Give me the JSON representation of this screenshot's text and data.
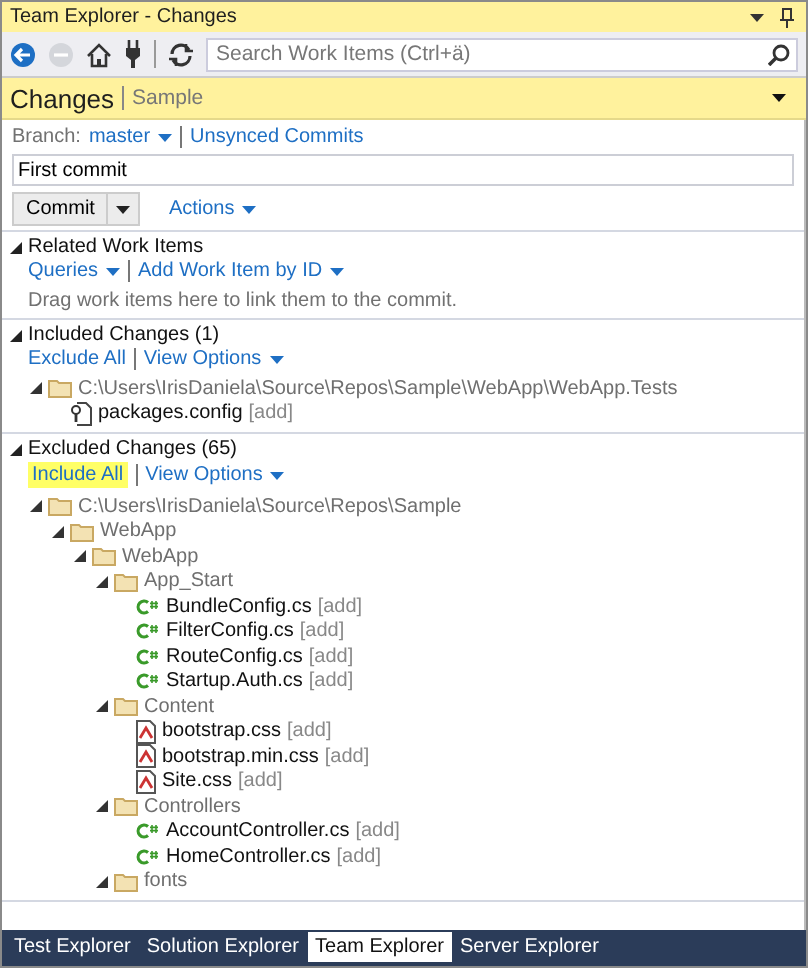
{
  "window": {
    "title": "Team Explorer - Changes"
  },
  "toolbar": {
    "search": {
      "placeholder": "Search Work Items (Ctrl+ä)"
    }
  },
  "header": {
    "title": "Changes",
    "subtitle": "Sample"
  },
  "branch": {
    "label": "Branch:",
    "value": "master",
    "link": "Unsynced Commits"
  },
  "commit_message": {
    "value": "First commit"
  },
  "commit_button": "Commit",
  "actions": "Actions",
  "sections": [
    {
      "title": "Related Work Items",
      "expanded": true,
      "links": [
        {
          "label": "Queries",
          "dropdown": true,
          "highlighted": false
        },
        {
          "label": "Add Work Item by ID",
          "dropdown": true,
          "highlighted": false
        }
      ],
      "hint": "Drag work items here to link them to the commit."
    },
    {
      "title": "Included Changes (1)",
      "expanded": true,
      "links": [
        {
          "label": "Exclude All",
          "dropdown": false,
          "highlighted": false
        },
        {
          "label": "View Options",
          "dropdown": true,
          "highlighted": false
        }
      ],
      "tree": [
        {
          "kind": "folder",
          "label": "C:\\Users\\IrisDaniela\\Source\\Repos\\Sample\\WebApp\\WebApp.Tests",
          "expanded": true,
          "children": [
            {
              "kind": "config",
              "label": "packages.config",
              "tag": "[add]"
            }
          ]
        }
      ]
    },
    {
      "title": "Excluded Changes (65)",
      "expanded": true,
      "links": [
        {
          "label": "Include All",
          "dropdown": false,
          "highlighted": true
        },
        {
          "label": "View Options",
          "dropdown": true,
          "highlighted": false
        }
      ],
      "tree": [
        {
          "kind": "folder",
          "label": "C:\\Users\\IrisDaniela\\Source\\Repos\\Sample",
          "expanded": true,
          "children": [
            {
              "kind": "folder",
              "label": "WebApp",
              "expanded": true,
              "children": [
                {
                  "kind": "folder",
                  "label": "WebApp",
                  "expanded": true,
                  "children": [
                    {
                      "kind": "folder",
                      "label": "App_Start",
                      "expanded": true,
                      "children": [
                        {
                          "kind": "cs",
                          "label": "BundleConfig.cs",
                          "tag": "[add]"
                        },
                        {
                          "kind": "cs",
                          "label": "FilterConfig.cs",
                          "tag": "[add]"
                        },
                        {
                          "kind": "cs",
                          "label": "RouteConfig.cs",
                          "tag": "[add]"
                        },
                        {
                          "kind": "cs",
                          "label": "Startup.Auth.cs",
                          "tag": "[add]"
                        }
                      ]
                    },
                    {
                      "kind": "folder",
                      "label": "Content",
                      "expanded": true,
                      "children": [
                        {
                          "kind": "css",
                          "label": "bootstrap.css",
                          "tag": "[add]"
                        },
                        {
                          "kind": "css",
                          "label": "bootstrap.min.css",
                          "tag": "[add]"
                        },
                        {
                          "kind": "css",
                          "label": "Site.css",
                          "tag": "[add]"
                        }
                      ]
                    },
                    {
                      "kind": "folder",
                      "label": "Controllers",
                      "expanded": true,
                      "children": [
                        {
                          "kind": "cs",
                          "label": "AccountController.cs",
                          "tag": "[add]"
                        },
                        {
                          "kind": "cs",
                          "label": "HomeController.cs",
                          "tag": "[add]"
                        }
                      ]
                    },
                    {
                      "kind": "folder",
                      "label": "fonts",
                      "expanded": true
                    }
                  ]
                }
              ]
            }
          ]
        }
      ]
    }
  ],
  "bottom_tabs": [
    {
      "label": "Test Explorer",
      "selected": false
    },
    {
      "label": "Solution Explorer",
      "selected": false
    },
    {
      "label": "Team Explorer",
      "selected": true
    },
    {
      "label": "Server Explorer",
      "selected": false
    }
  ]
}
